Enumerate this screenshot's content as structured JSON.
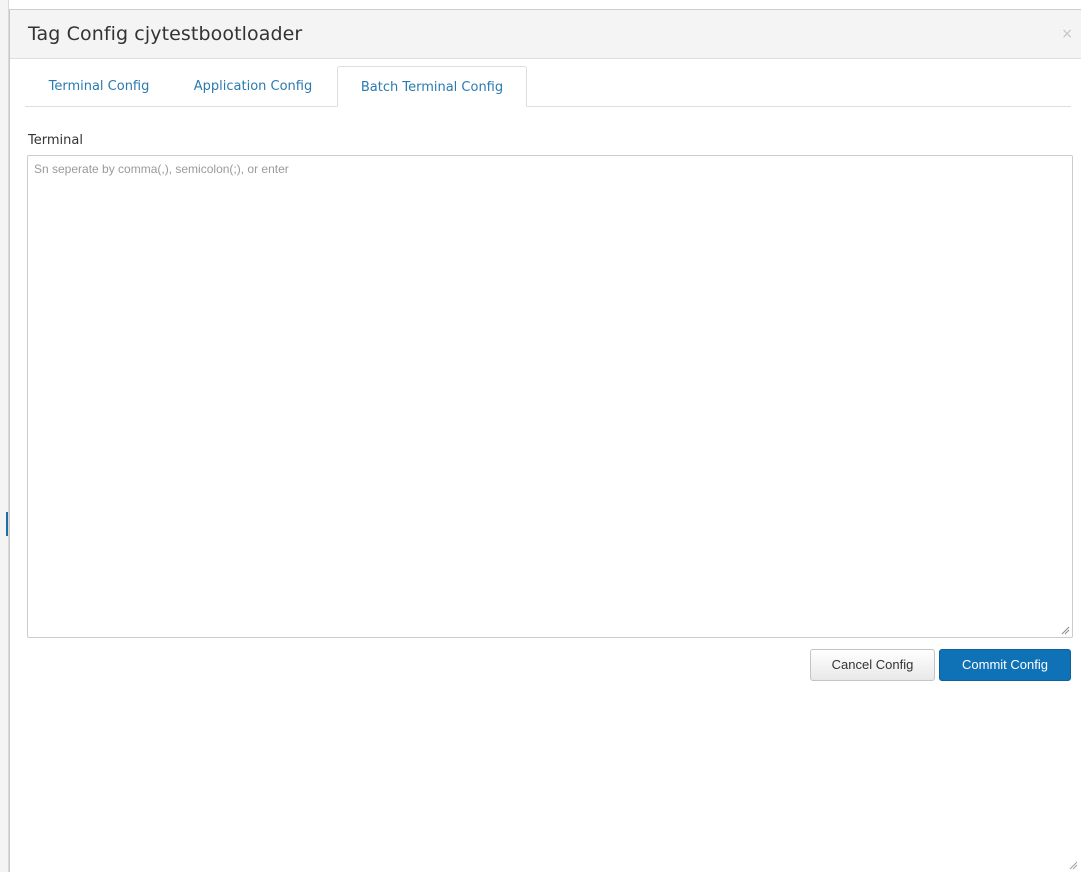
{
  "modal": {
    "title": "Tag Config cjytestbootloader",
    "close_icon": "×"
  },
  "tabs": [
    {
      "label": "Terminal Config",
      "active": false
    },
    {
      "label": "Application Config",
      "active": false
    },
    {
      "label": "Batch Terminal Config",
      "active": true
    }
  ],
  "form": {
    "terminal_label": "Terminal",
    "terminal_value": "",
    "terminal_placeholder": "Sn seperate by comma(,), semicolon(;), or enter"
  },
  "buttons": {
    "cancel_label": "Cancel Config",
    "commit_label": "Commit Config"
  },
  "colors": {
    "link": "#2a7ab0",
    "primary": "#0f72b6"
  },
  "icons": {
    "close": "close-icon",
    "resize": "resize-grip-icon"
  }
}
